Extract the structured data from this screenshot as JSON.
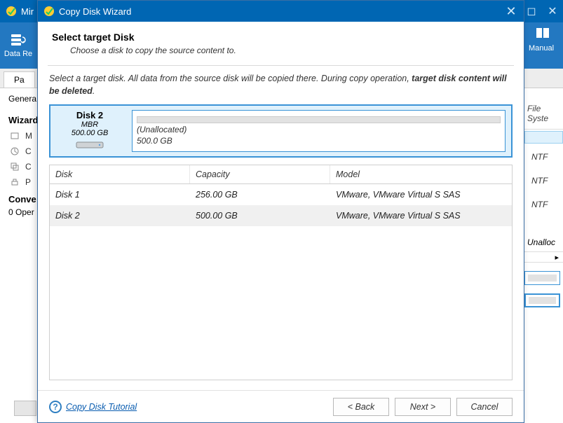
{
  "parent": {
    "title_prefix": "Mir",
    "toolbar": {
      "data_recovery": "Data Re",
      "manual": "Manual"
    },
    "tabs": {
      "partition": "Pa",
      "general": "Genera"
    },
    "wizards_heading": "Wizard",
    "wizard_items": [
      "M",
      "C",
      "C",
      "P"
    ],
    "ops_heading": "Conve",
    "ops_count": "0 Oper",
    "right": {
      "col_head": "File Syste",
      "rows": [
        "NTF",
        "NTF",
        "NTF"
      ],
      "unalloc": "Unalloc"
    }
  },
  "wizard": {
    "title": "Copy Disk Wizard",
    "heading": "Select target Disk",
    "subheading": "Choose a disk to copy the source content to.",
    "instruction_prefix": "Select a target disk. All data from the source disk will be copied there. During copy operation, ",
    "instruction_bold": "target disk content will be deleted",
    "selected": {
      "name": "Disk 2",
      "type": "MBR",
      "size": "500.00 GB",
      "unalloc_label": "(Unallocated)",
      "unalloc_size": "500.0 GB"
    },
    "columns": {
      "disk": "Disk",
      "capacity": "Capacity",
      "model": "Model"
    },
    "rows": [
      {
        "disk": "Disk 1",
        "capacity": "256.00 GB",
        "model": "VMware, VMware Virtual S SAS",
        "selected": false
      },
      {
        "disk": "Disk 2",
        "capacity": "500.00 GB",
        "model": "VMware, VMware Virtual S SAS",
        "selected": true
      }
    ],
    "help_link": "Copy Disk Tutorial",
    "buttons": {
      "back": "< Back",
      "next": "Next >",
      "cancel": "Cancel"
    }
  }
}
